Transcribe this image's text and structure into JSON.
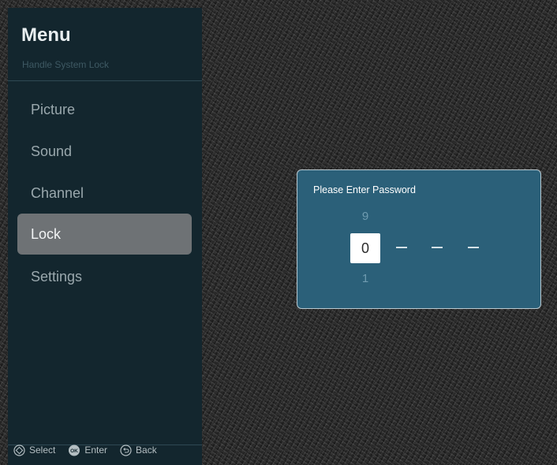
{
  "menu": {
    "title": "Menu",
    "subtitle": "Handle System Lock",
    "items": [
      {
        "label": "Picture",
        "active": false
      },
      {
        "label": "Sound",
        "active": false
      },
      {
        "label": "Channel",
        "active": false
      },
      {
        "label": "Lock",
        "active": true
      },
      {
        "label": "Settings",
        "active": false
      }
    ]
  },
  "footer": {
    "select_label": "Select",
    "enter_label": "Enter",
    "enter_icon_text": "OK",
    "back_label": "Back"
  },
  "dialog": {
    "title": "Please Enter Password",
    "digit_prev": "9",
    "digit_current": "0",
    "digit_next": "1"
  },
  "colors": {
    "sidebar": "#13262e",
    "active_item": "#6e7275",
    "dialog": "#2b6079"
  }
}
